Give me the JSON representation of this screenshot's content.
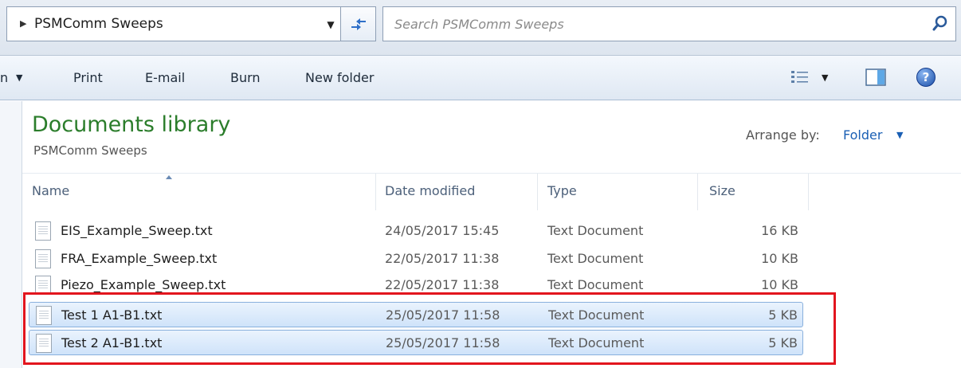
{
  "address": {
    "path": "PSMComm Sweeps",
    "breadcrumb_arrow_icon": "chevron-right-icon",
    "dropdown_icon": "chevron-down-icon",
    "refresh_icon": "refresh-icon"
  },
  "search": {
    "placeholder": "Search PSMComm Sweeps",
    "icon": "search-icon"
  },
  "commandbar": {
    "cut_off_label": "n",
    "print": "Print",
    "email": "E-mail",
    "burn": "Burn",
    "new_folder": "New folder",
    "icons": [
      "views-icon",
      "preview-pane-icon",
      "help-icon"
    ]
  },
  "library": {
    "title": "Documents library",
    "subtitle": "PSMComm Sweeps",
    "arrange_label": "Arrange by:",
    "arrange_value": "Folder"
  },
  "columns": {
    "name": "Name",
    "date": "Date modified",
    "type": "Type",
    "size": "Size"
  },
  "files": [
    {
      "name": "EIS_Example_Sweep.txt",
      "date": "24/05/2017 15:45",
      "type": "Text Document",
      "size": "16 KB",
      "selected": false
    },
    {
      "name": "FRA_Example_Sweep.txt",
      "date": "22/05/2017 11:38",
      "type": "Text Document",
      "size": "10 KB",
      "selected": false
    },
    {
      "name": "Piezo_Example_Sweep.txt",
      "date": "22/05/2017 11:38",
      "type": "Text Document",
      "size": "10 KB",
      "selected": false
    },
    {
      "name": "Test 1 A1-B1.txt",
      "date": "25/05/2017 11:58",
      "type": "Text Document",
      "size": "5 KB",
      "selected": true
    },
    {
      "name": "Test 2 A1-B1.txt",
      "date": "25/05/2017 11:58",
      "type": "Text Document",
      "size": "5 KB",
      "selected": true
    }
  ],
  "colors": {
    "library_title": "#2b7d2b",
    "link": "#1a5fb4",
    "selection": "#cfe3fa",
    "annotation_box": "#e2151e"
  }
}
